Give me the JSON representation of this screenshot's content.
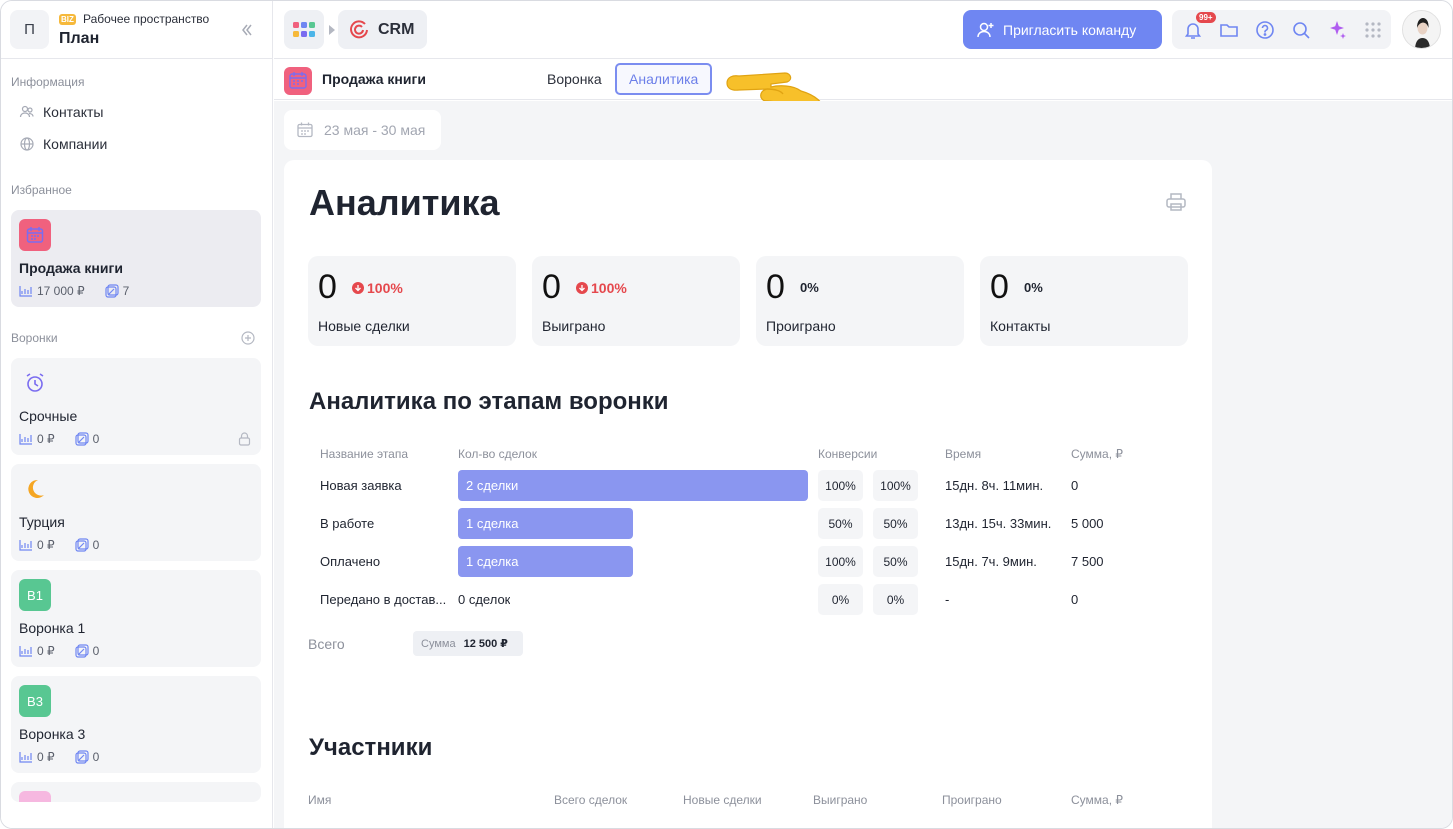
{
  "workspace": {
    "avatar_letter": "П",
    "biz": "BIZ",
    "subtitle": "Рабочее пространство",
    "name": "План"
  },
  "sidebar": {
    "info_label": "Информация",
    "contacts": "Контакты",
    "companies": "Компании",
    "favorites_label": "Избранное",
    "favorite": {
      "title": "Продажа книги",
      "amount": "17 000 ₽",
      "count": "7"
    },
    "funnels_label": "Воронки",
    "funnels": [
      {
        "title": "Срочные",
        "amount": "0 ₽",
        "count": "0",
        "icon": "alarm-clock-icon",
        "locked": true
      },
      {
        "title": "Турция",
        "amount": "0 ₽",
        "count": "0",
        "icon": "crescent-moon-icon"
      },
      {
        "title": "Воронка 1",
        "amount": "0 ₽",
        "count": "0",
        "badge": "В1",
        "badge_color": "#58c792"
      },
      {
        "title": "Воронка 3",
        "amount": "0 ₽",
        "count": "0",
        "badge": "В3",
        "badge_color": "#58c792"
      }
    ]
  },
  "topbar": {
    "crm_label": "CRM",
    "invite_label": "Пригласить команду",
    "notif_badge": "99+",
    "accent": "#6f86f2"
  },
  "subheader": {
    "title": "Продажа книги",
    "tabs": [
      {
        "label": "Воронка",
        "active": false
      },
      {
        "label": "Аналитика",
        "active": true
      }
    ]
  },
  "filters": {
    "date_range": "23 мая - 30 мая"
  },
  "analytics": {
    "title": "Аналитика",
    "stats": [
      {
        "value": "0",
        "delta": "100%",
        "trend": "down",
        "label": "Новые сделки"
      },
      {
        "value": "0",
        "delta": "100%",
        "trend": "down",
        "label": "Выиграно"
      },
      {
        "value": "0",
        "delta": "0%",
        "trend": "none",
        "label": "Проиграно"
      },
      {
        "value": "0",
        "delta": "0%",
        "trend": "none",
        "label": "Контакты"
      }
    ],
    "stages_title": "Аналитика по этапам воронки",
    "stages_headers": {
      "name": "Название этапа",
      "deals": "Кол-во сделок",
      "conv": "Конверсии",
      "time": "Время",
      "sum": "Сумма, ₽"
    },
    "stages": [
      {
        "name": "Новая заявка",
        "deals": "2 сделки",
        "deal_share": 1.0,
        "conv1": "100%",
        "conv2": "100%",
        "time": "15дн. 8ч. 11мин.",
        "sum": "0"
      },
      {
        "name": "В работе",
        "deals": "1 сделка",
        "deal_share": 0.5,
        "conv1": "50%",
        "conv2": "50%",
        "time": "13дн. 15ч. 33мин.",
        "sum": "5 000"
      },
      {
        "name": "Оплачено",
        "deals": "1 сделка",
        "deal_share": 0.5,
        "conv1": "100%",
        "conv2": "50%",
        "time": "15дн. 7ч. 9мин.",
        "sum": "7 500"
      },
      {
        "name": "Передано в достав...",
        "deals": "0 сделок",
        "deal_share": 0,
        "conv1": "0%",
        "conv2": "0%",
        "time": "-",
        "sum": "0"
      }
    ],
    "total_label": "Всего",
    "total_sum_key": "Сумма",
    "total_sum_value": "12 500 ₽",
    "participants_title": "Участники",
    "participants_headers": {
      "name": "Имя",
      "total": "Всего сделок",
      "new": "Новые сделки",
      "won": "Выиграно",
      "lost": "Проиграно",
      "sum": "Сумма, ₽"
    }
  }
}
